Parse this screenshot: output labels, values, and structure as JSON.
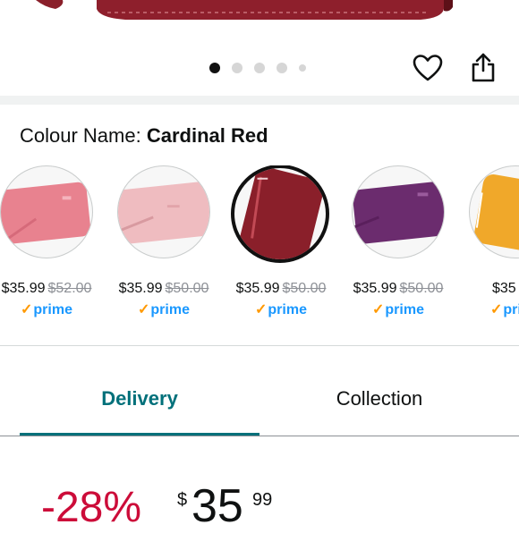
{
  "colour": {
    "label": "Colour Name: ",
    "value": "Cardinal Red"
  },
  "carousel": {
    "dot_count": 5,
    "active_index": 0
  },
  "swatches": [
    {
      "name": "pink",
      "price": "$35.99",
      "was_price": "$52.00",
      "prime": "prime",
      "color": "#e8828f",
      "selected": false
    },
    {
      "name": "light-pink",
      "price": "$35.99",
      "was_price": "$50.00",
      "prime": "prime",
      "color": "#efbcc0",
      "selected": false
    },
    {
      "name": "cardinal-red",
      "price": "$35.99",
      "was_price": "$50.00",
      "prime": "prime",
      "color": "#8a1f2a",
      "selected": true
    },
    {
      "name": "purple",
      "price": "$35.99",
      "was_price": "$50.00",
      "prime": "prime",
      "color": "#6b2c6e",
      "selected": false
    },
    {
      "name": "mustard",
      "price": "$35",
      "was_price": "",
      "prime": "pri",
      "color": "#f0a82a",
      "selected": false
    }
  ],
  "tabs": {
    "delivery": "Delivery",
    "collection": "Collection",
    "active": "delivery"
  },
  "pricing": {
    "discount": "-28%",
    "currency": "$",
    "whole": "35",
    "fraction": "99"
  },
  "colors": {
    "accent": "#00707a",
    "discount_red": "#cc0c39",
    "prime_blue": "#1a98ff",
    "prime_check": "#ff9900"
  }
}
